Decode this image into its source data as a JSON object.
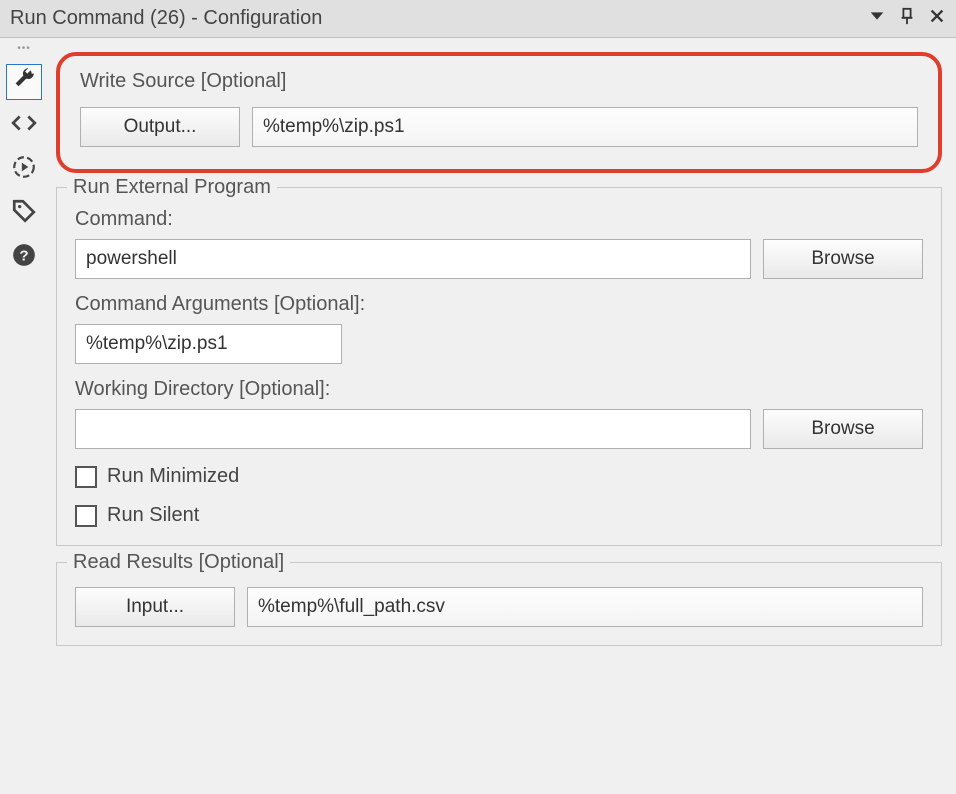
{
  "title": "Run Command (26) - Configuration",
  "write_source": {
    "label": "Write Source [Optional]",
    "output_button": "Output...",
    "value": "%temp%\\zip.ps1"
  },
  "run_external": {
    "legend": "Run External Program",
    "command_label": "Command:",
    "command_value": "powershell",
    "browse_label": "Browse",
    "arguments_label": "Command Arguments [Optional]:",
    "arguments_value": "%temp%\\zip.ps1",
    "workdir_label": "Working Directory [Optional]:",
    "workdir_value": "",
    "run_minimized_label": "Run Minimized",
    "run_silent_label": "Run Silent"
  },
  "read_results": {
    "legend": "Read Results [Optional]",
    "input_button": "Input...",
    "value": "%temp%\\full_path.csv"
  }
}
